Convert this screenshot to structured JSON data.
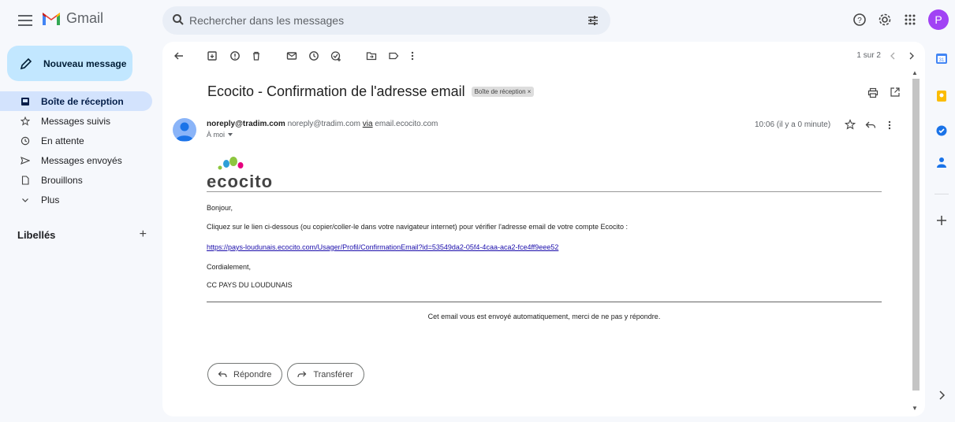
{
  "app": {
    "name": "Gmail"
  },
  "colors": {
    "brand_red": "#ea4335",
    "brand_blue": "#4285f4",
    "brand_yellow": "#fbbc04",
    "brand_green": "#34a853",
    "compose_bg": "#c2e7ff",
    "active_nav": "#d3e3fd",
    "avatar": "#a142f4",
    "link": "#1a0dab"
  },
  "search": {
    "placeholder": "Rechercher dans les messages"
  },
  "user": {
    "avatar_letter": "P"
  },
  "compose": {
    "label": "Nouveau message"
  },
  "nav": {
    "items": [
      {
        "label": "Boîte de réception",
        "icon": "inbox-icon"
      },
      {
        "label": "Messages suivis",
        "icon": "star-icon"
      },
      {
        "label": "En attente",
        "icon": "clock-icon"
      },
      {
        "label": "Messages envoyés",
        "icon": "send-icon"
      },
      {
        "label": "Brouillons",
        "icon": "draft-icon"
      },
      {
        "label": "Plus",
        "icon": "chevron-down-icon"
      }
    ]
  },
  "labels": {
    "heading": "Libellés",
    "add": "+"
  },
  "toolbar": {
    "pager": "1 sur 2"
  },
  "message": {
    "subject": "Ecocito - Confirmation de l'adresse email",
    "badge": "Boîte de réception ×",
    "sender_name": "noreply@tradim.com",
    "sender_email": "noreply@tradim.com",
    "via_label": "via",
    "via_domain": "email.ecocito.com",
    "to": "À moi",
    "time": "10:06 (il y a 0 minute)"
  },
  "email_body": {
    "brand": "ecocito",
    "greeting": "Bonjour,",
    "instruction": "Cliquez sur le lien ci-dessous (ou copier/coller-le dans votre navigateur internet) pour vérifier l'adresse email de votre compte Ecocito :",
    "link": "https://pays-loudunais.ecocito.com/Usager/Profil/ConfirmationEmail?id=53549da2-05f4-4caa-aca2-fce4ff9eee52",
    "closing": "Cordialement,",
    "signature": "CC PAYS DU LOUDUNAIS",
    "footer": "Cet email vous est envoyé automatiquement, merci de ne pas y répondre."
  },
  "actions": {
    "reply": "Répondre",
    "forward": "Transférer"
  }
}
